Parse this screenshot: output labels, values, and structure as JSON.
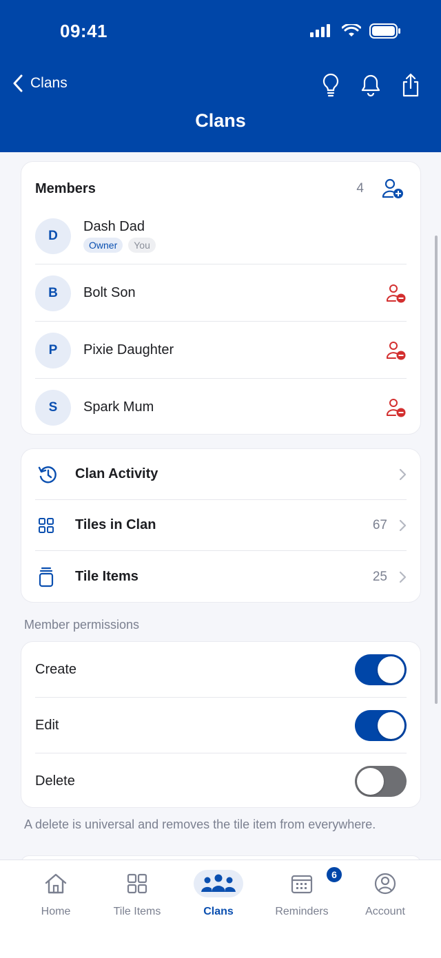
{
  "status": {
    "time": "09:41"
  },
  "nav": {
    "back_label": "Clans",
    "title": "Clans"
  },
  "members": {
    "title": "Members",
    "count": "4",
    "list": [
      {
        "initial": "D",
        "name": "Dash Dad",
        "badges": [
          "Owner",
          "You"
        ]
      },
      {
        "initial": "B",
        "name": "Bolt Son"
      },
      {
        "initial": "P",
        "name": "Pixie Daughter"
      },
      {
        "initial": "S",
        "name": "Spark Mum"
      }
    ]
  },
  "links": [
    {
      "label": "Clan Activity",
      "value": "",
      "icon": "history-icon"
    },
    {
      "label": "Tiles in Clan",
      "value": "67",
      "icon": "grid-icon"
    },
    {
      "label": "Tile Items",
      "value": "25",
      "icon": "jar-icon"
    }
  ],
  "permissions": {
    "section_label": "Member permissions",
    "items": [
      {
        "label": "Create",
        "enabled": true
      },
      {
        "label": "Edit",
        "enabled": true
      },
      {
        "label": "Delete",
        "enabled": false
      }
    ],
    "footnote": "A delete is universal and removes the tile item from everywhere."
  },
  "tabbar": {
    "tabs": [
      {
        "label": "Home",
        "icon": "home-icon"
      },
      {
        "label": "Tile Items",
        "icon": "grid-icon"
      },
      {
        "label": "Clans",
        "icon": "people-icon",
        "active": true
      },
      {
        "label": "Reminders",
        "icon": "calendar-icon",
        "badge": "6"
      },
      {
        "label": "Account",
        "icon": "account-icon"
      }
    ]
  },
  "colors": {
    "brand": "#0046a8",
    "danger": "#d32f2f",
    "muted": "#7b8090"
  }
}
